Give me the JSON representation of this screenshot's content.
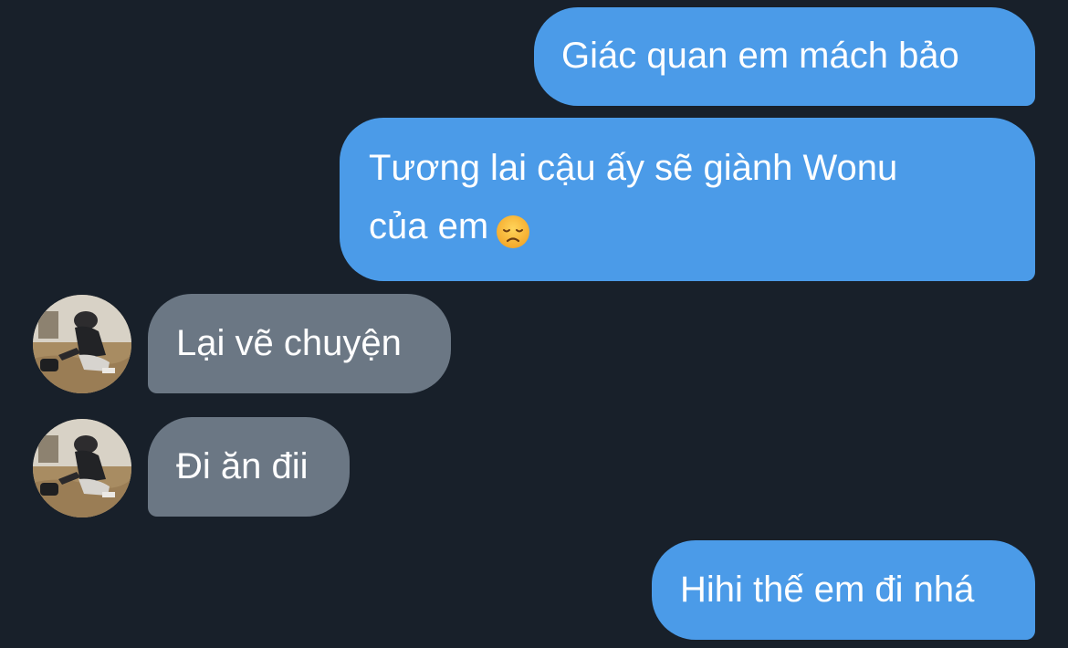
{
  "conversation": {
    "messages": [
      {
        "sender": "me",
        "lines": [
          "Giác quan em mách bảo"
        ]
      },
      {
        "sender": "me",
        "lines": [
          "Tương lai cậu ấy sẽ giành Wonu",
          "của em"
        ],
        "trailing_emoji": "disappointed-face-emoji"
      },
      {
        "sender": "contact",
        "lines": [
          "Lại vẽ chuyện"
        ]
      },
      {
        "sender": "contact",
        "lines": [
          "Đi ăn đii"
        ]
      },
      {
        "sender": "me",
        "lines": [
          "Hihi thế em đi nhá"
        ]
      }
    ]
  },
  "colors": {
    "background": "#18202a",
    "outgoing_bubble": "#4b9be8",
    "incoming_bubble": "#6b7784",
    "text": "#ffffff"
  }
}
